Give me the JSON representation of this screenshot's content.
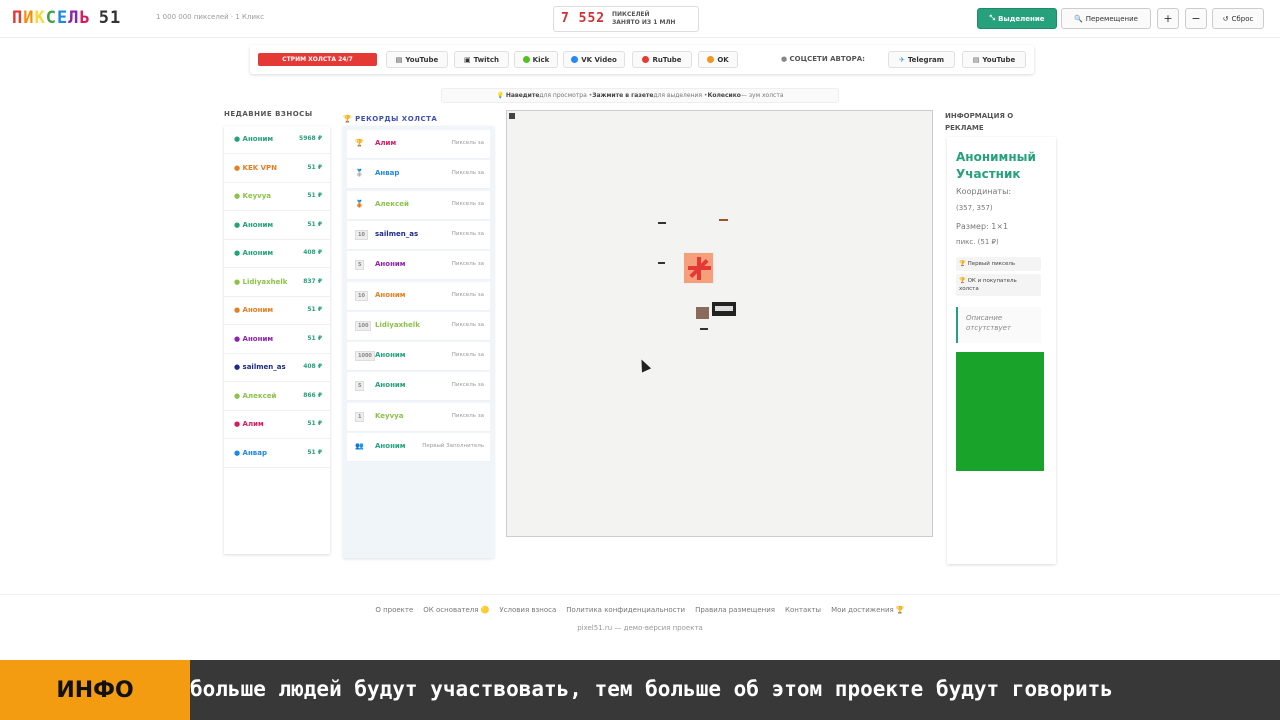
{
  "header": {
    "logo_letters": [
      "П",
      "И",
      "К",
      "С",
      "Е",
      "Л",
      "Ь"
    ],
    "logo_number": "51",
    "logo_sub": "1 000 000 пикселей · 1 Кликс",
    "counter_value": "7 552",
    "counter_line1": "ПИКСЕЛЕЙ",
    "counter_line2": "ЗАНЯТО ИЗ 1 МЛН",
    "select_label": "Выделение",
    "move_label": "Перемещение",
    "zoom_in": "+",
    "zoom_out": "−",
    "reset_label": "Сброс"
  },
  "social": {
    "live_label": "СТРИМ ХОЛСТА 24/7",
    "platforms": [
      {
        "label": "YouTube",
        "icon": "film-icon",
        "color": "#555555"
      },
      {
        "label": "Twitch",
        "icon": "twitch-icon",
        "color": "#555555"
      },
      {
        "label": "Kick",
        "icon": "kick-icon",
        "color": "#53c11f"
      },
      {
        "label": "VK Video",
        "icon": "vk-icon",
        "color": "#2787f5"
      },
      {
        "label": "RuTube",
        "icon": "rutube-icon",
        "color": "#e53935"
      },
      {
        "label": "OK",
        "icon": "ok-icon",
        "color": "#f7931e"
      }
    ],
    "author_label": "СОЦСЕТИ АВТОРА:",
    "author_links": [
      {
        "label": "Telegram",
        "icon": "telegram-icon"
      },
      {
        "label": "YouTube",
        "icon": "youtube-icon"
      }
    ]
  },
  "hint": {
    "p1b": "Наведите",
    "p1": " для просмотра • ",
    "p2b": "Зажмите в газете",
    "p2": " для выделения • ",
    "p3b": "Колесико",
    "p3": " — зум холста"
  },
  "recent": {
    "title": "НЕДАВНИЕ ВЗНОСЫ",
    "items": [
      {
        "name": "Аноним",
        "amount": "5968 ₽",
        "color": "#26a17b"
      },
      {
        "name": "KEK VPN",
        "amount": "51 ₽",
        "color": "#e67e22"
      },
      {
        "name": "Keyvya",
        "amount": "51 ₽",
        "color": "#8bc34a"
      },
      {
        "name": "Аноним",
        "amount": "51 ₽",
        "color": "#26a17b"
      },
      {
        "name": "Аноним",
        "amount": "408 ₽",
        "color": "#26a17b"
      },
      {
        "name": "Lidiyaxhelk",
        "amount": "837 ₽",
        "color": "#8bc34a"
      },
      {
        "name": "Аноним",
        "amount": "51 ₽",
        "color": "#e67e22"
      },
      {
        "name": "Аноним",
        "amount": "51 ₽",
        "color": "#8e24aa"
      },
      {
        "name": "sailmen_as",
        "amount": "408 ₽",
        "color": "#1e2a8a"
      },
      {
        "name": "Алексей",
        "amount": "866 ₽",
        "color": "#8bc34a"
      },
      {
        "name": "Алим",
        "amount": "51 ₽",
        "color": "#d81b60"
      },
      {
        "name": "Анвар",
        "amount": "51 ₽",
        "color": "#1e88e5"
      }
    ]
  },
  "records": {
    "title": "РЕКОРДЫ ХОЛСТА",
    "items": [
      {
        "icon": "🏆",
        "name": "Алим",
        "desc": "Пиксель за",
        "color": "#d81b60"
      },
      {
        "icon": "🥈",
        "name": "Анвар",
        "desc": "Пиксель за",
        "color": "#1e88e5"
      },
      {
        "icon": "🥉",
        "name": "Алексей",
        "desc": "Пиксель за",
        "color": "#8bc34a"
      },
      {
        "badge": "10",
        "name": "sailmen_as",
        "desc": "Пиксель за",
        "color": "#1e2a8a"
      },
      {
        "badge": "5",
        "name": "Аноним",
        "desc": "Пиксель за",
        "color": "#8e24aa"
      },
      {
        "badge": "10",
        "name": "Аноним",
        "desc": "Пиксель за",
        "color": "#e67e22"
      },
      {
        "badge": "100",
        "name": "Lidiyaxhelk",
        "desc": "Пиксель за",
        "color": "#8bc34a"
      },
      {
        "badge": "1000",
        "name": "Аноним",
        "desc": "Пиксель за",
        "color": "#26a17b"
      },
      {
        "badge": "5",
        "name": "Аноним",
        "desc": "Пиксель за",
        "color": "#26a17b"
      },
      {
        "badge": "1",
        "name": "Keyvya",
        "desc": "Пиксель за",
        "color": "#8bc34a"
      },
      {
        "icon": "👥",
        "name": "Аноним",
        "desc": "Первый Заполнитель",
        "color": "#26a17b"
      }
    ]
  },
  "ad": {
    "title_line1": "ИНФОРМАЦИЯ О",
    "title_line2": "РЕКЛАМЕ",
    "name": "Анонимный Участник",
    "coords_label": "Координаты:",
    "coords": "(357, 357)",
    "size_label": "Размер: 1×1",
    "size_value": "пикс. (51 ₽)",
    "badge1": "🏆 Первый пиксель",
    "badge2": "🏆 ОК и покупатель холста",
    "desc": "Описание отсутствует",
    "green": "#1aa32a"
  },
  "footer": {
    "links": [
      "О проекте",
      "ОК основателя 🟡",
      "Условия взноса",
      "Политика конфиденциальности",
      "Правила размещения",
      "Контакты",
      "Мои достижения 🏆"
    ],
    "sub": "pixel51.ru — демо-версия проекта"
  },
  "ticker": {
    "label": "ИНФО",
    "text": "больше людей будут участвовать, тем больше об этом проекте будут говорить"
  }
}
